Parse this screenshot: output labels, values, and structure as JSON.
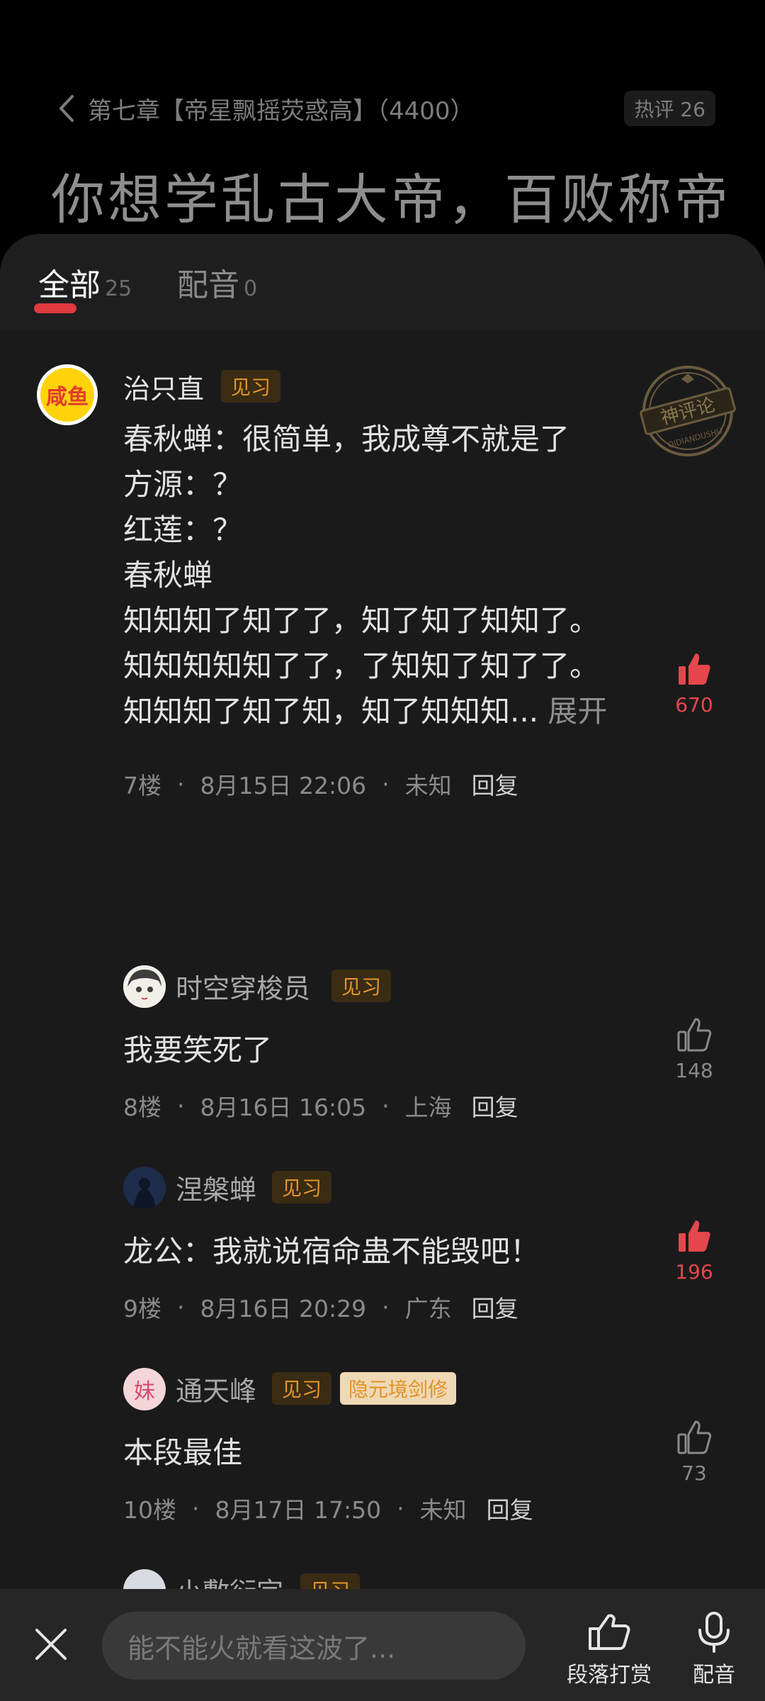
{
  "header": {
    "back_text": "第七章【帝星飘摇荧惑高】（4400）",
    "hot_label": "热评 26",
    "quote": "你想学乱古大帝，百败称帝"
  },
  "tabs": [
    {
      "label": "全部",
      "count": "25"
    },
    {
      "label": "配音",
      "count": "0"
    }
  ],
  "seal_text": "神评论",
  "seal_sub": "QIDIANDUSHU",
  "comments": [
    {
      "user": "治只直",
      "avatar_text": "咸鱼",
      "level": "见习",
      "text": "春秋蝉：很简单，我成尊不就是了\n方源：？\n红莲：？\n春秋蝉\n知知知了知了了，知了知了知知了。\n知知知知知了了，了知知了知了了。\n知知知了知了知，知了知知知... ",
      "expand": "展开",
      "floor": "7楼",
      "time": "8月15日 22:06",
      "location": "未知",
      "reply": "回复",
      "likes": "670",
      "liked": true
    },
    {
      "user": "时空穿梭员",
      "level": "见习",
      "text": "我要笑死了",
      "floor": "8楼",
      "time": "8月16日 16:05",
      "location": "上海",
      "reply": "回复",
      "likes": "148",
      "liked": false
    },
    {
      "user": "涅槃蝉",
      "level": "见习",
      "text": "龙公：我就说宿命蛊不能毁吧！",
      "floor": "9楼",
      "time": "8月16日 20:29",
      "location": "广东",
      "reply": "回复",
      "likes": "196",
      "liked": true
    },
    {
      "user": "通天峰",
      "avatar_text": "妹",
      "level": "见习",
      "title": "隐元境剑修",
      "text": "本段最佳",
      "floor": "10楼",
      "time": "8月17日 17:50",
      "location": "未知",
      "reply": "回复",
      "likes": "73",
      "liked": false
    },
    {
      "user": "小敷衍宗",
      "level": "见习"
    }
  ],
  "bottom": {
    "input_placeholder": "能不能火就看这波了...",
    "reward_label": "段落打赏",
    "voice_label": "配音"
  },
  "colors": {
    "accent": "#e4474c",
    "badge_text": "#e0952a",
    "badge_bg": "#3a2b13",
    "sheet_bg": "#1a1a1a"
  }
}
